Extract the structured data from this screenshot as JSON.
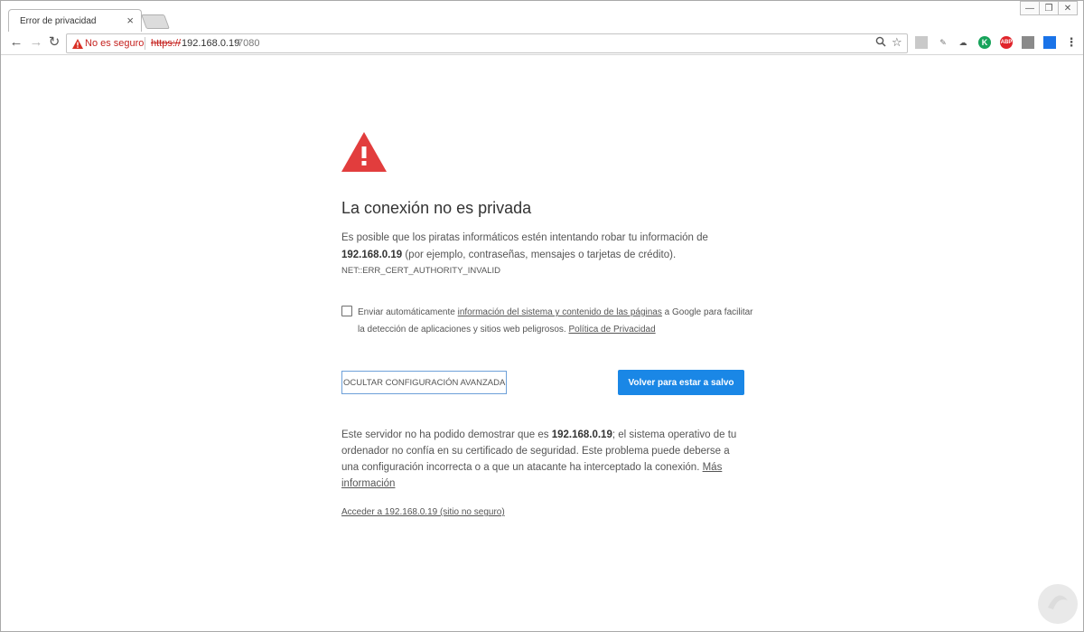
{
  "tab": {
    "title": "Error de privacidad",
    "close": "×"
  },
  "window": {
    "minimize": "—",
    "restore": "❐",
    "close": "✕"
  },
  "nav": {
    "back": "←",
    "forward": "→",
    "reload": "↻"
  },
  "omnibox": {
    "security_label": "No es seguro",
    "scheme": "https://",
    "host": "192.168.0.19",
    "port": ":7080",
    "search_icon": "🔍",
    "star_icon": "☆"
  },
  "extensions": [
    "ext-1",
    "ext-2",
    "ext-3",
    "kaspersky-k",
    "adblock-abp",
    "ext-6",
    "ext-7"
  ],
  "error": {
    "title": "La conexión no es privada",
    "body_prefix": "Es posible que los piratas informáticos estén intentando robar tu información de ",
    "host": "192.168.0.19",
    "body_suffix": " (por ejemplo, contraseñas, mensajes o tarjetas de crédito).",
    "code": "NET::ERR_CERT_AUTHORITY_INVALID",
    "checkbox_prefix": "Enviar automáticamente ",
    "checkbox_link": "información del sistema y contenido de las páginas",
    "checkbox_middle": " a Google para facilitar la detección de aplicaciones y sitios web peligrosos. ",
    "privacy_link": "Política de Privacidad",
    "advanced_button": "OCULTAR CONFIGURACIÓN AVANZADA",
    "safe_button": "Volver para estar a salvo",
    "detail_prefix": "Este servidor no ha podido demostrar que es ",
    "detail_host": "192.168.0.19",
    "detail_suffix": "; el sistema operativo de tu ordenador no confía en su certificado de seguridad. Este problema puede deberse a una configuración incorrecta o a que un atacante ha interceptado la conexión. ",
    "more_info_link": "Más información",
    "proceed_link": "Acceder a 192.168.0.19 (sitio no seguro)"
  },
  "colors": {
    "accent": "#1a87e6",
    "danger": "#e23d3d",
    "insecure_text": "#c5221f"
  }
}
